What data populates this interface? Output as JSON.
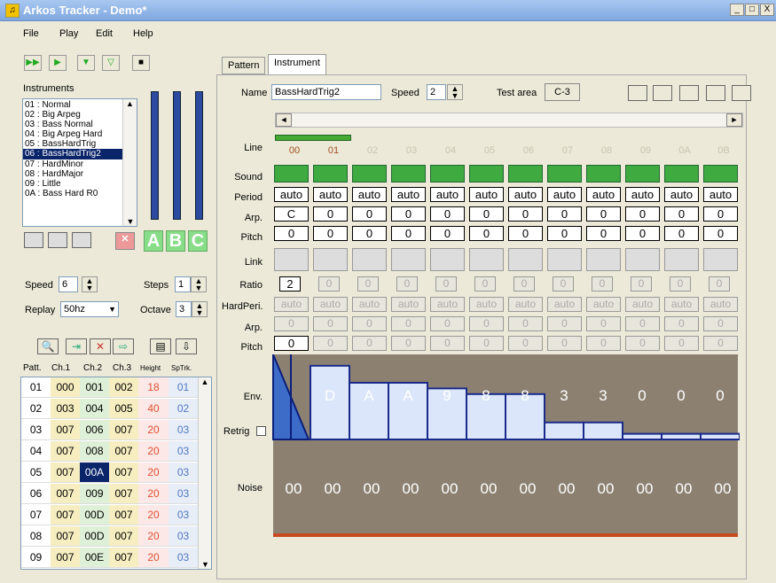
{
  "window": {
    "title": "Arkos Tracker - Demo*",
    "controls": [
      "_",
      "□",
      "X"
    ]
  },
  "menu": [
    "File",
    "Play",
    "Edit",
    "Help"
  ],
  "toolbar": {
    "icons": [
      "play-song-icon",
      "play-pattern-icon",
      "play-line-icon",
      "play-from-cursor-icon",
      "stop-icon"
    ]
  },
  "instruments": {
    "label": "Instruments",
    "items": [
      "01 : Normal",
      "02 : Big Arpeg",
      "03 : Bass Normal",
      "04 : Big Arpeg Hard",
      "05 : BassHardTrig",
      "06 : BassHardTrig2",
      "07 : HardMinor",
      "08 : HardMajor",
      "09 : Little",
      "0A : Bass Hard R0"
    ],
    "selected_index": 5
  },
  "abc": [
    "A",
    "B",
    "C"
  ],
  "settings": {
    "speed_label": "Speed",
    "speed": "6",
    "steps_label": "Steps",
    "steps": "1",
    "replay_label": "Replay",
    "replay": "50hz",
    "octave_label": "Octave",
    "octave": "3"
  },
  "pattern_list": {
    "headers": [
      "Patt.",
      "Ch.1",
      "Ch.2",
      "Ch.3",
      "Height",
      "SpTrk."
    ],
    "rows": [
      [
        "01",
        "000",
        "001",
        "002",
        "18",
        "01"
      ],
      [
        "02",
        "003",
        "004",
        "005",
        "40",
        "02"
      ],
      [
        "03",
        "007",
        "006",
        "007",
        "20",
        "03"
      ],
      [
        "04",
        "007",
        "008",
        "007",
        "20",
        "03"
      ],
      [
        "05",
        "007",
        "00A",
        "007",
        "20",
        "03"
      ],
      [
        "06",
        "007",
        "009",
        "007",
        "20",
        "03"
      ],
      [
        "07",
        "007",
        "00D",
        "007",
        "20",
        "03"
      ],
      [
        "08",
        "007",
        "00D",
        "007",
        "20",
        "03"
      ],
      [
        "09",
        "007",
        "00E",
        "007",
        "20",
        "03"
      ]
    ],
    "selected_cell": [
      4,
      2
    ]
  },
  "tabs": [
    "Pattern",
    "Instrument"
  ],
  "active_tab": "Instrument",
  "editor": {
    "name_label": "Name",
    "name": "BassHardTrig2",
    "speed_label": "Speed",
    "speed": "2",
    "test_area_label": "Test area",
    "test_note": "C-3",
    "lines": [
      "00",
      "01",
      "02",
      "03",
      "04",
      "05",
      "06",
      "07",
      "08",
      "09",
      "0A",
      "0B"
    ],
    "row_labels": {
      "line": "Line",
      "sound": "Sound",
      "period": "Period",
      "arp": "Arp.",
      "pitch": "Pitch",
      "link": "Link",
      "ratio": "Ratio",
      "hardperi": "HardPeri.",
      "arp2": "Arp.",
      "pitch2": "Pitch",
      "env": "Env.",
      "retrig": "Retrig",
      "noise": "Noise"
    },
    "period": [
      "auto",
      "auto",
      "auto",
      "auto",
      "auto",
      "auto",
      "auto",
      "auto",
      "auto",
      "auto",
      "auto",
      "auto"
    ],
    "arp": [
      "C",
      "0",
      "0",
      "0",
      "0",
      "0",
      "0",
      "0",
      "0",
      "0",
      "0",
      "0"
    ],
    "pitch": [
      "0",
      "0",
      "0",
      "0",
      "0",
      "0",
      "0",
      "0",
      "0",
      "0",
      "0",
      "0"
    ],
    "ratio": [
      "2",
      "0",
      "0",
      "0",
      "0",
      "0",
      "0",
      "0",
      "0",
      "0",
      "0",
      "0"
    ],
    "hardperi": [
      "auto",
      "auto",
      "auto",
      "auto",
      "auto",
      "auto",
      "auto",
      "auto",
      "auto",
      "auto",
      "auto",
      "auto"
    ],
    "arp2": [
      "0",
      "0",
      "0",
      "0",
      "0",
      "0",
      "0",
      "0",
      "0",
      "0",
      "0",
      "0"
    ],
    "pitch2": [
      "0",
      "0",
      "0",
      "0",
      "0",
      "0",
      "0",
      "0",
      "0",
      "0",
      "0",
      "0"
    ],
    "env_labels": [
      "D",
      "A",
      "A",
      "9",
      "8",
      "8",
      "3",
      "3",
      "0",
      "0",
      "0"
    ],
    "env_values": [
      13,
      10,
      10,
      9,
      8,
      8,
      3,
      3,
      1,
      1,
      1
    ],
    "noise": [
      "00",
      "00",
      "00",
      "00",
      "00",
      "00",
      "00",
      "00",
      "00",
      "00",
      "00",
      "00"
    ]
  }
}
